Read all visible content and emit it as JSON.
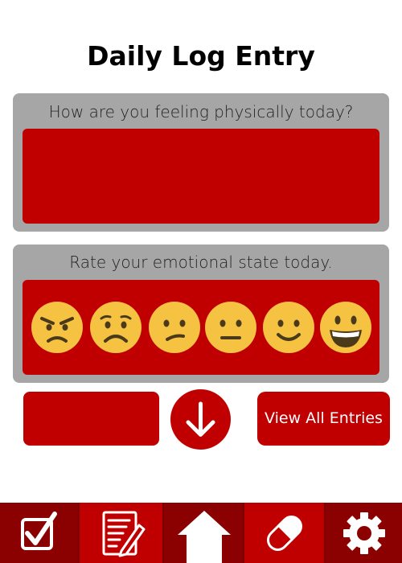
{
  "header": {
    "title": "Daily Log Entry"
  },
  "physical": {
    "prompt": "How are you feeling physically today?",
    "value": ""
  },
  "emotional": {
    "prompt": "Rate your emotional state today.",
    "options": [
      "angry-face-icon",
      "frowning-face-icon",
      "confused-face-icon",
      "neutral-face-icon",
      "slight-smile-icon",
      "grinning-face-icon"
    ]
  },
  "actions": {
    "view_all_label": "View All Entries",
    "down_icon": "arrow-down-icon"
  },
  "nav": {
    "items": [
      "checkbox-icon",
      "notes-icon",
      "home-icon",
      "pill-icon",
      "gear-icon"
    ],
    "colors": {
      "bar": "#c00000",
      "dark": "#8b0000"
    }
  },
  "colors": {
    "accent": "#c00000",
    "card": "#a6a6a6",
    "emoji": "#f5c242"
  }
}
